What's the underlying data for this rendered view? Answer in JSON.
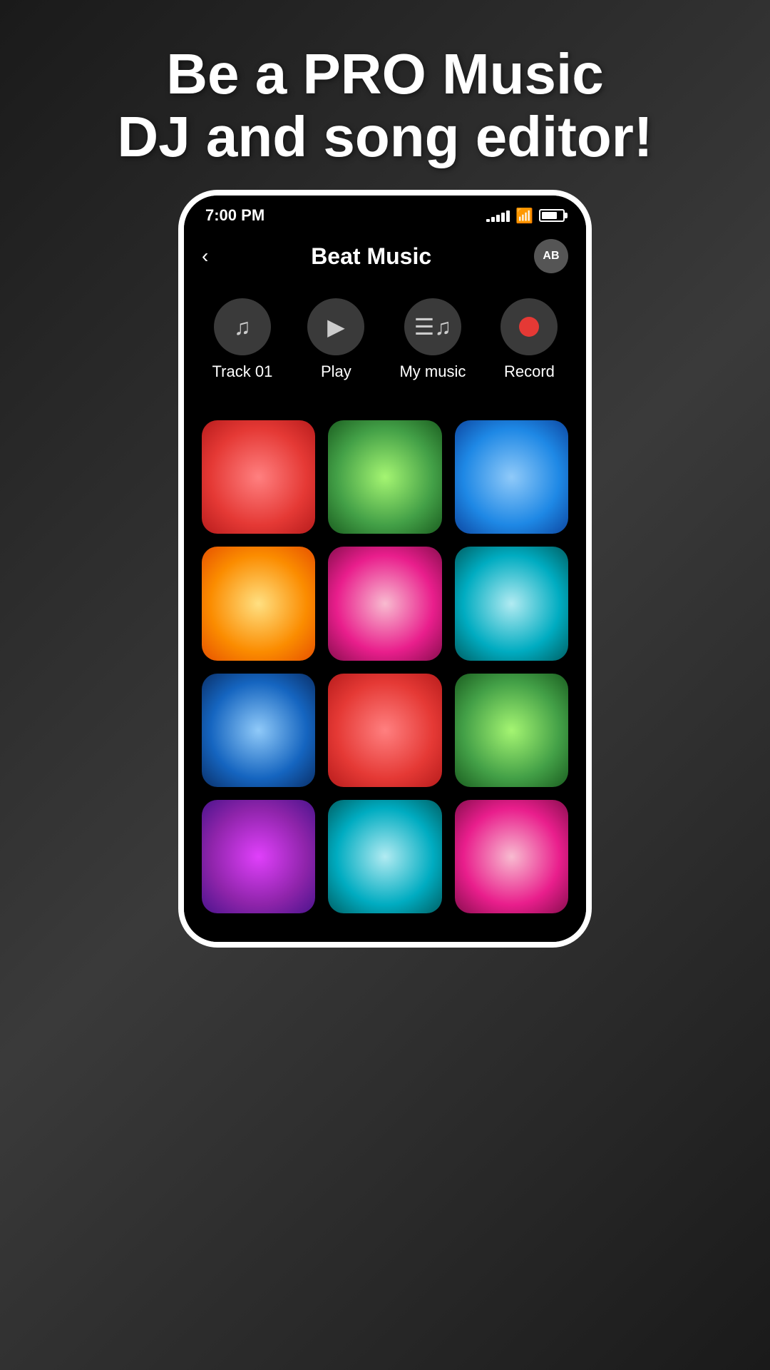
{
  "headline": {
    "line1": "Be a PRO Music",
    "line2": "DJ and song editor!"
  },
  "status_bar": {
    "time": "7:00 PM",
    "signal_bars": [
      4,
      7,
      10,
      13,
      16
    ],
    "battery_level": 75
  },
  "app_header": {
    "title": "Beat Music",
    "ab_label": "AB",
    "back_icon": "‹"
  },
  "toolbar": {
    "items": [
      {
        "id": "track01",
        "label": "Track 01",
        "icon_type": "music-note"
      },
      {
        "id": "play",
        "label": "Play",
        "icon_type": "play"
      },
      {
        "id": "mymusic",
        "label": "My music",
        "icon_type": "playlist"
      },
      {
        "id": "record",
        "label": "Record",
        "icon_type": "record"
      }
    ]
  },
  "pads": {
    "rows": [
      [
        "red",
        "green",
        "blue"
      ],
      [
        "orange",
        "pink",
        "cyan"
      ],
      [
        "blue2",
        "red2",
        "green2"
      ],
      [
        "purple",
        "cyan2",
        "pink2"
      ]
    ]
  },
  "colors": {
    "accent": "#e53935",
    "background": "#000000",
    "toolbar_bg": "#3a3a3a",
    "text": "#ffffff"
  }
}
